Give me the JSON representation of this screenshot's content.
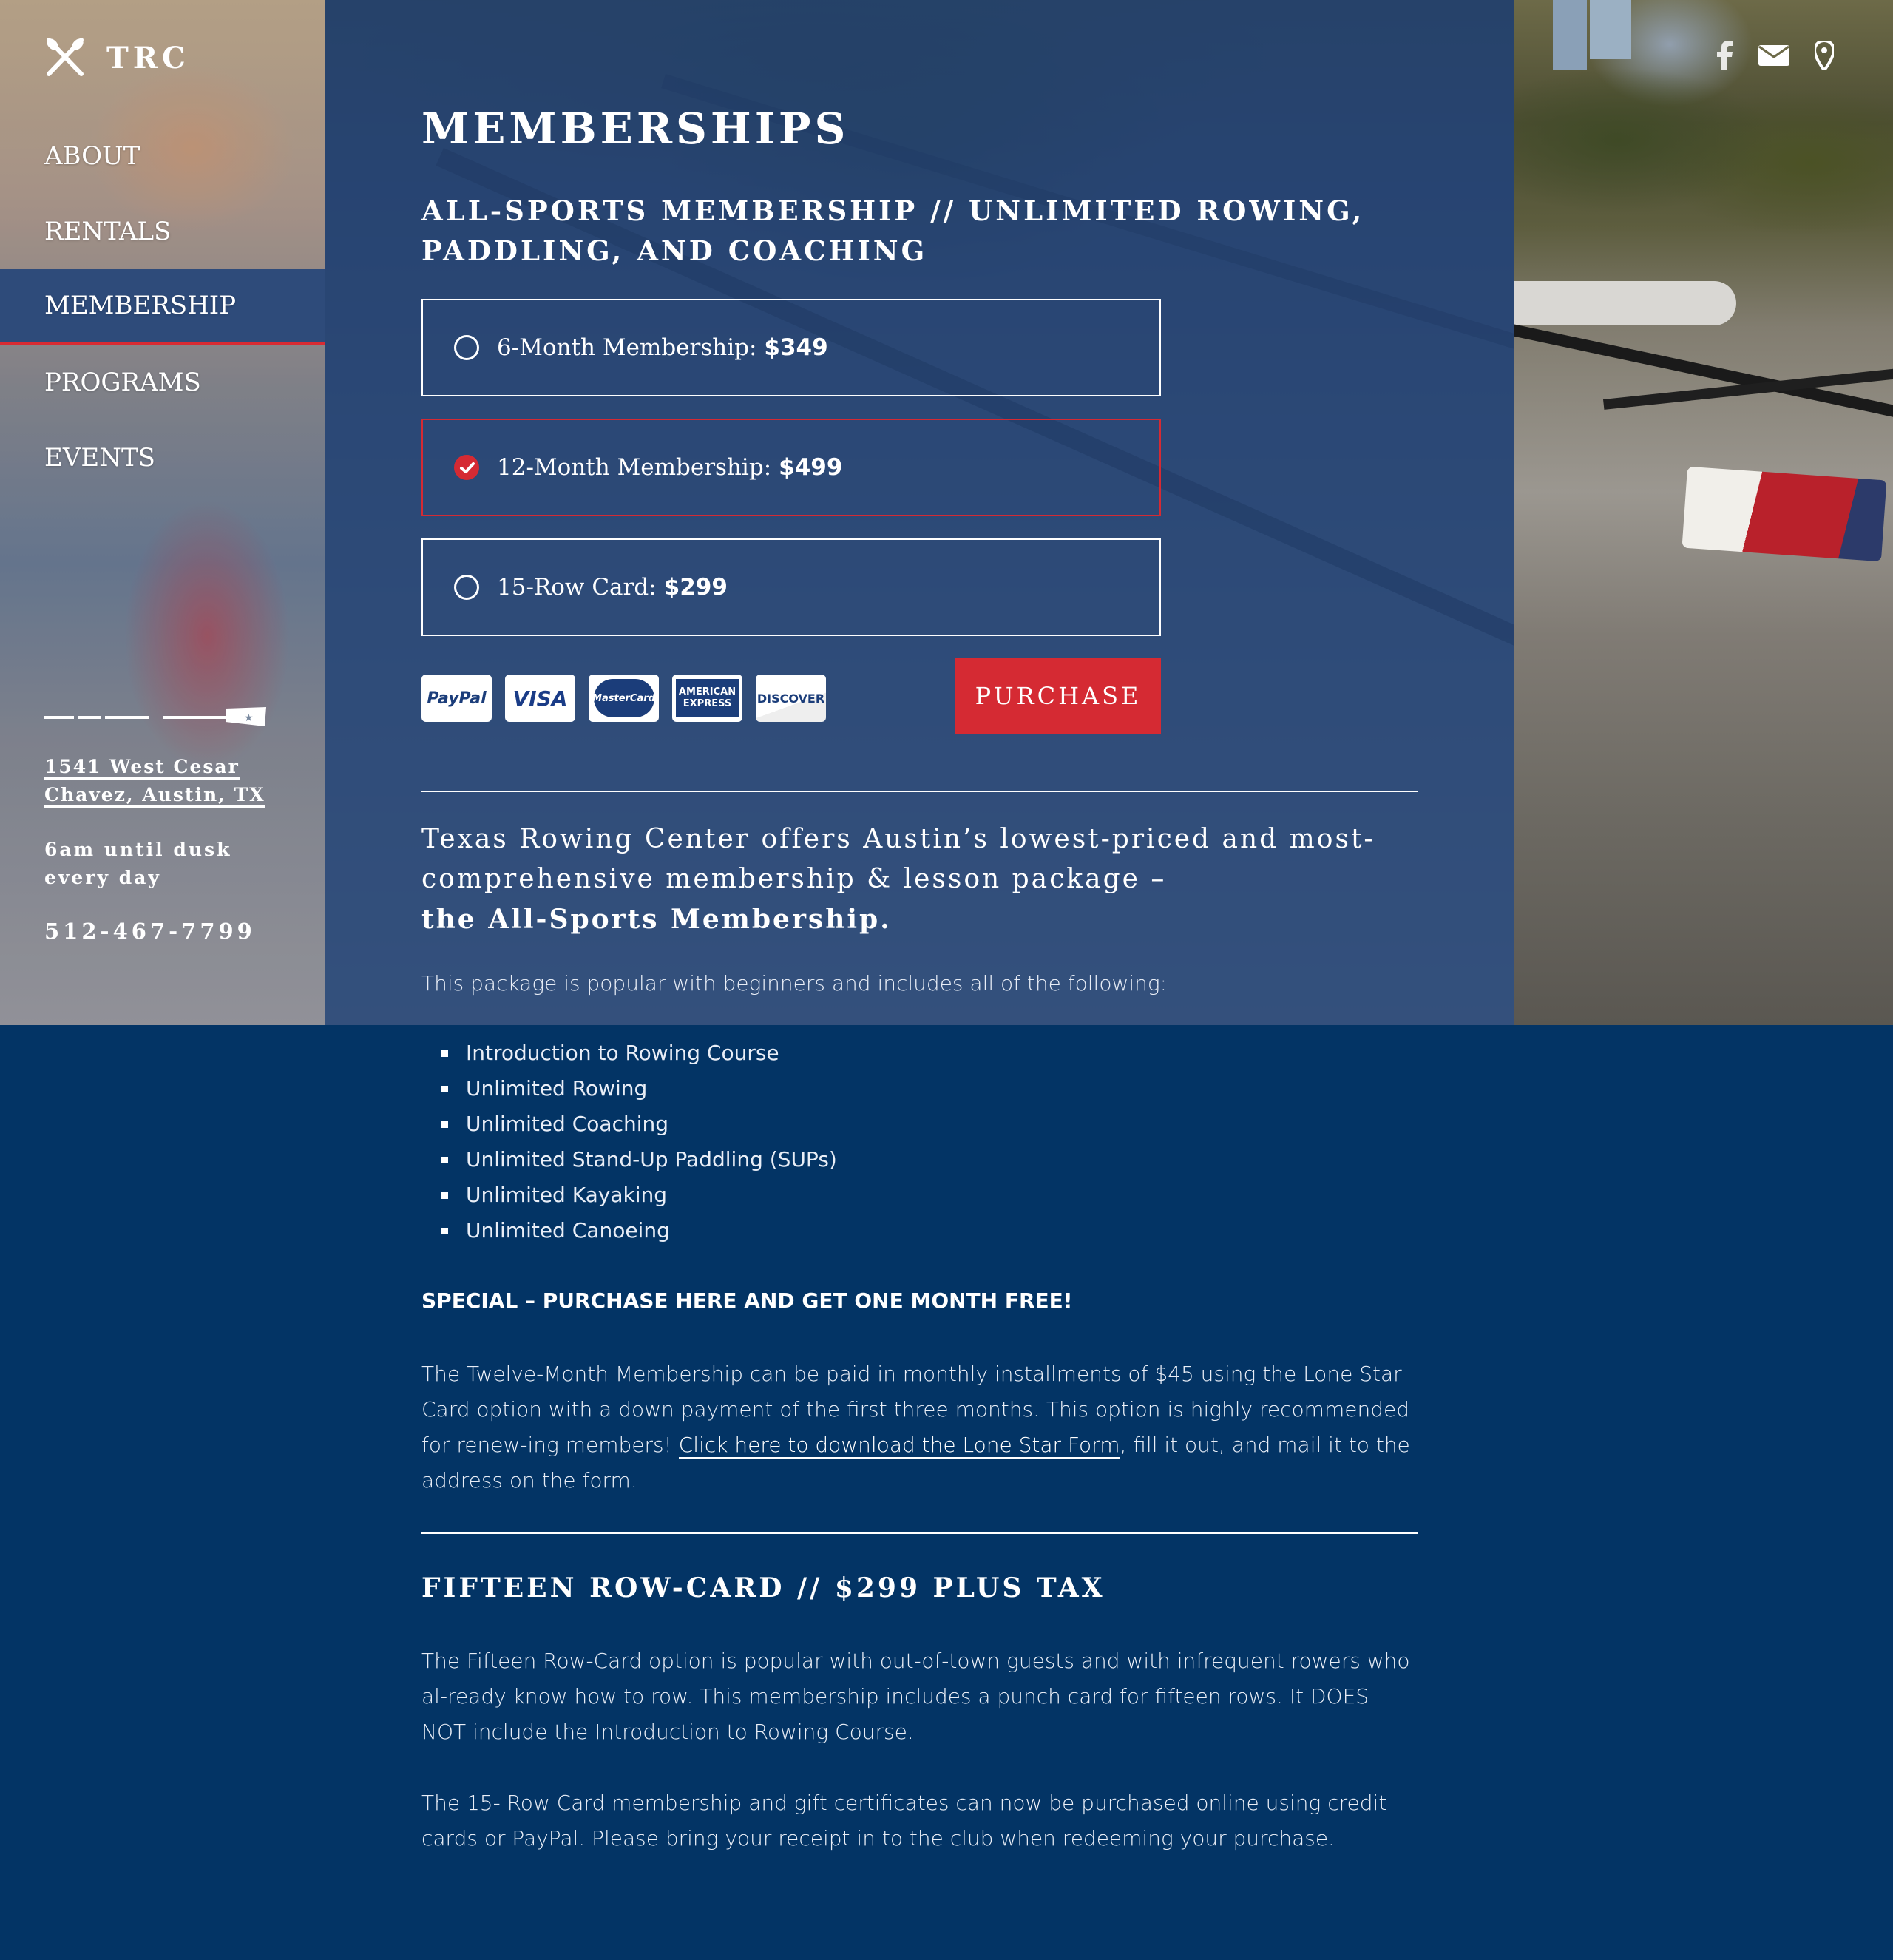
{
  "sidebar": {
    "logo_text": "TRC",
    "nav": [
      "ABOUT",
      "RENTALS",
      "MEMBERSHIP",
      "PROGRAMS",
      "EVENTS"
    ],
    "active_nav": "MEMBERSHIP",
    "address_line1": "1541 West Cesar",
    "address_line2": "Chavez, Austin, TX",
    "hours_line1": "6am until dusk",
    "hours_line2": "every day",
    "phone": "512-467-7799"
  },
  "header": {
    "icons": [
      "facebook-icon",
      "envelope-icon",
      "map-pin-icon"
    ]
  },
  "main": {
    "page_title": "MEMBERSHIPS",
    "membership_heading_bold": "ALL-SPORTS MEMBERSHIP",
    "membership_heading_rest": " // UNLIMITED ROWING, PADDLING, AND COACHING",
    "options": [
      {
        "label": "6-Month Membership:",
        "price": "$349",
        "selected": false
      },
      {
        "label": "12-Month Membership:",
        "price": "$499",
        "selected": true
      },
      {
        "label": "15-Row Card:",
        "price": "$299",
        "selected": false
      }
    ],
    "payment_methods": [
      "PayPal",
      "VISA",
      "MasterCard",
      "AMERICAN EXPRESS",
      "DISCOVER"
    ],
    "purchase_label": "PURCHASE",
    "intro_text": "Texas Rowing Center offers Austin’s lowest-priced and most-comprehensive membership & lesson package –",
    "intro_bold": "the All-Sports Membership.",
    "package_text": "This package is popular with beginners and includes all of the following:",
    "includes": [
      "Introduction to Rowing Course",
      "Unlimited Rowing",
      "Unlimited Coaching",
      "Unlimited Stand-Up Paddling (SUPs)",
      "Unlimited Kayaking",
      "Unlimited Canoeing"
    ],
    "special": "SPECIAL – PURCHASE HERE AND GET ONE MONTH FREE!",
    "installment_text_before": "The Twelve-Month Membership can be paid in monthly installments of $45 using the Lone Star Card option with a down payment of the first three months. This option is highly recommended for renew-ing members! ",
    "installment_link": "Click here to download the Lone Star Form",
    "installment_text_after": ", fill it out, and mail it to the address on the form.",
    "row_card_heading_bold": "FIFTEEN ROW-CARD",
    "row_card_heading_rest": " // $299 PLUS TAX",
    "row_card_text1": "The Fifteen Row-Card option is popular with out-of-town guests and with infrequent rowers who al-ready know how to row. This membership includes a punch card for fifteen rows. It DOES NOT include the Introduction to Rowing Course.",
    "row_card_text2": "The 15- Row Card membership and gift certificates can now be purchased online using credit cards or PayPal. Please bring your receipt in to the club when redeeming your purchase."
  },
  "colors": {
    "navy": "#033465",
    "accent_red": "#d52a33",
    "panel_blue": "#224070"
  }
}
